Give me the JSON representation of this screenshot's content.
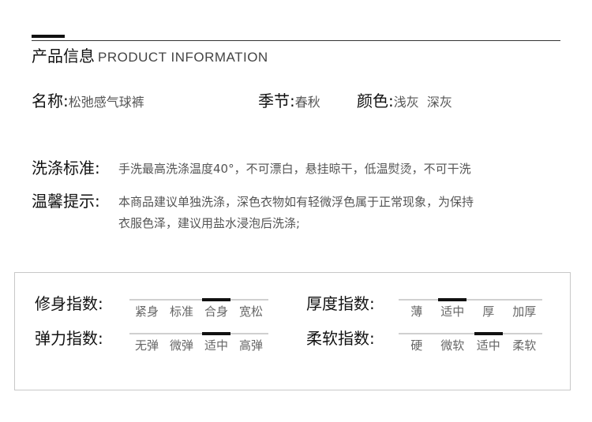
{
  "header": {
    "title_cn": "产品信息",
    "title_en": "PRODUCT INFORMATION"
  },
  "info": {
    "name_label": "名称:",
    "name_value": "松弛感气球裤",
    "season_label": "季节:",
    "season_value": "春秋",
    "color_label": "颜色:",
    "color_value": "浅灰  深灰",
    "wash_label": "洗涤标准:",
    "wash_value": "手洗最高洗涤温度40°，不可漂白，悬挂晾干，低温熨烫，不可干洗",
    "tips_label": "温馨提示:",
    "tips_line1": "本商品建议单独洗涤，深色衣物如有轻微浮色属于正常现象，为保持",
    "tips_line2": "衣服色泽，建议用盐水浸泡后洗涤;"
  },
  "indices": {
    "fit": {
      "label": "修身指数:",
      "options": [
        "紧身",
        "标准",
        "合身",
        "宽松"
      ],
      "selected": 2
    },
    "thickness": {
      "label": "厚度指数:",
      "options": [
        "薄",
        "适中",
        "厚",
        "加厚"
      ],
      "selected": 1
    },
    "stretch": {
      "label": "弹力指数:",
      "options": [
        "无弹",
        "微弹",
        "适中",
        "高弹"
      ],
      "selected": 2
    },
    "softness": {
      "label": "柔软指数:",
      "options": [
        "硬",
        "微软",
        "适中",
        "柔软"
      ],
      "selected": 2
    }
  },
  "colors": {
    "accent": "#111111",
    "track": "#d0d0d0",
    "text_muted": "#555555"
  }
}
